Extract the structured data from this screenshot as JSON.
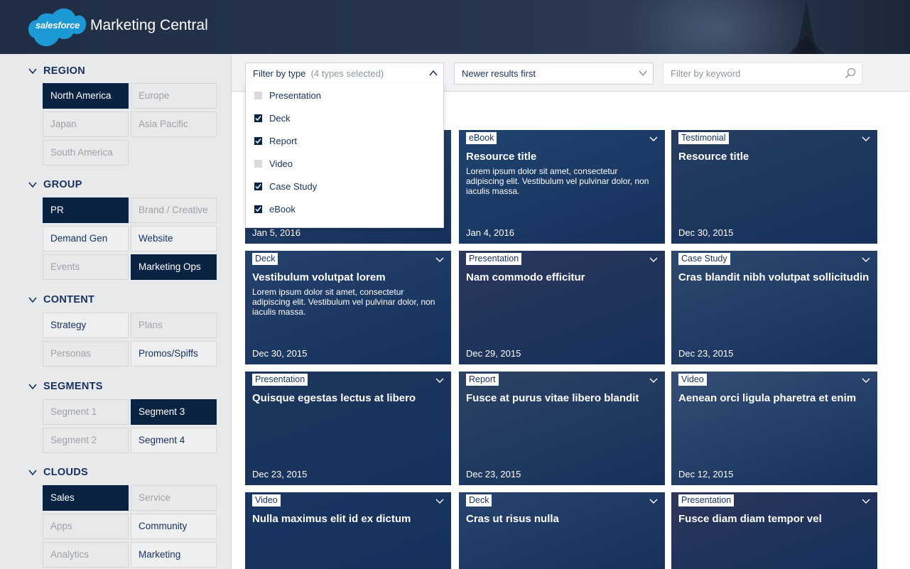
{
  "header": {
    "logo_text": "salesforce",
    "app_title": "Marketing Central",
    "colors": {
      "header_bg": "#27364e",
      "logo_blue": "#1d9ad6"
    }
  },
  "sidebar": {
    "sections": [
      {
        "label": "REGION",
        "chips": [
          {
            "label": "North America",
            "state": "selected"
          },
          {
            "label": "Europe",
            "state": "disabled"
          },
          {
            "label": "Japan",
            "state": "disabled"
          },
          {
            "label": "Asia Pacific",
            "state": "disabled"
          },
          {
            "label": "South America",
            "state": "disabled"
          }
        ]
      },
      {
        "label": "GROUP",
        "chips": [
          {
            "label": "PR",
            "state": "selected"
          },
          {
            "label": "Brand / Creative",
            "state": "disabled"
          },
          {
            "label": "Demand Gen",
            "state": "available"
          },
          {
            "label": "Website",
            "state": "available"
          },
          {
            "label": "Events",
            "state": "disabled"
          },
          {
            "label": "Marketing Ops",
            "state": "selected"
          }
        ]
      },
      {
        "label": "CONTENT",
        "chips": [
          {
            "label": "Strategy",
            "state": "available"
          },
          {
            "label": "Plans",
            "state": "disabled"
          },
          {
            "label": "Personas",
            "state": "disabled"
          },
          {
            "label": "Promos/Spiffs",
            "state": "available"
          }
        ]
      },
      {
        "label": "SEGMENTS",
        "chips": [
          {
            "label": "Segment 1",
            "state": "disabled"
          },
          {
            "label": "Segment 3",
            "state": "selected"
          },
          {
            "label": "Segment 2",
            "state": "disabled"
          },
          {
            "label": "Segment 4",
            "state": "available"
          }
        ]
      },
      {
        "label": "CLOUDS",
        "chips": [
          {
            "label": "Sales",
            "state": "selected"
          },
          {
            "label": "Service",
            "state": "disabled"
          },
          {
            "label": "Apps",
            "state": "disabled"
          },
          {
            "label": "Community",
            "state": "available"
          },
          {
            "label": "Analytics",
            "state": "disabled"
          },
          {
            "label": "Marketing",
            "state": "available"
          }
        ]
      }
    ]
  },
  "toolbar": {
    "type_filter": {
      "label": "Filter by type",
      "count": "(4 types selected)",
      "icon": "chevron-up-icon"
    },
    "sort": {
      "value": "Newer results first",
      "icon": "chevron-down-icon"
    },
    "keyword": {
      "placeholder": "Filter by keyword",
      "icon": "search-icon"
    }
  },
  "type_options": [
    {
      "label": "Presentation",
      "checked": false
    },
    {
      "label": "Deck",
      "checked": true
    },
    {
      "label": "Report",
      "checked": true
    },
    {
      "label": "Video",
      "checked": false
    },
    {
      "label": "Case Study",
      "checked": true
    },
    {
      "label": "eBook",
      "checked": true
    }
  ],
  "cards": [
    {
      "type": "",
      "title": "",
      "desc": "",
      "date": "Jan 5, 2016",
      "bg": "#3f5572"
    },
    {
      "type": "eBook",
      "title": "Resource title",
      "desc": "Lorem ipsum dolor sit amet, consectetur adipiscing elit. Vestibulum vel pulvinar dolor, non iaculis massa.",
      "date": "Jan 4, 2016",
      "bg": "#2f5a86"
    },
    {
      "type": "Testimonial",
      "title": "Resource title",
      "desc": "",
      "date": "Dec 30, 2015",
      "bg": "#3b4d66"
    },
    {
      "type": "Deck",
      "title": "Vestibulum volutpat lorem",
      "desc": "Lorem ipsum dolor sit amet, consectetur adipiscing elit. Vestibulum vel pulvinar dolor, non iaculis massa.",
      "date": "Dec 30, 2015",
      "bg": "#36577f"
    },
    {
      "type": "Presentation",
      "title": "Nam commodo efficitur",
      "desc": "",
      "date": "Dec 29, 2015",
      "bg": "#4a3f5c"
    },
    {
      "type": "Case Study",
      "title": "Cras blandit nibh volutpat sollicitudin",
      "desc": "",
      "date": "Dec 23, 2015",
      "bg": "#4d6686"
    },
    {
      "type": "Presentation",
      "title": "Quisque egestas lectus at libero",
      "desc": "",
      "date": "Dec 23, 2015",
      "bg": "#2b3f5f"
    },
    {
      "type": "Report",
      "title": "Fusce at purus vitae libero blandit",
      "desc": "",
      "date": "Dec 23, 2015",
      "bg": "#4a5a70"
    },
    {
      "type": "Video",
      "title": "Aenean orci ligula pharetra et enim",
      "desc": "",
      "date": "Dec 12, 2015",
      "bg": "#5b7393"
    },
    {
      "type": "Video",
      "title": "Nulla maximus elit id ex dictum",
      "desc": "",
      "date": "",
      "bg": "#1f3d68"
    },
    {
      "type": "Deck",
      "title": "Cras ut risus nulla",
      "desc": "",
      "date": "",
      "bg": "#3f5c82"
    },
    {
      "type": "Presentation",
      "title": "Fusce diam diam tempor vel",
      "desc": "",
      "date": "",
      "bg": "#4a3c5a"
    }
  ]
}
